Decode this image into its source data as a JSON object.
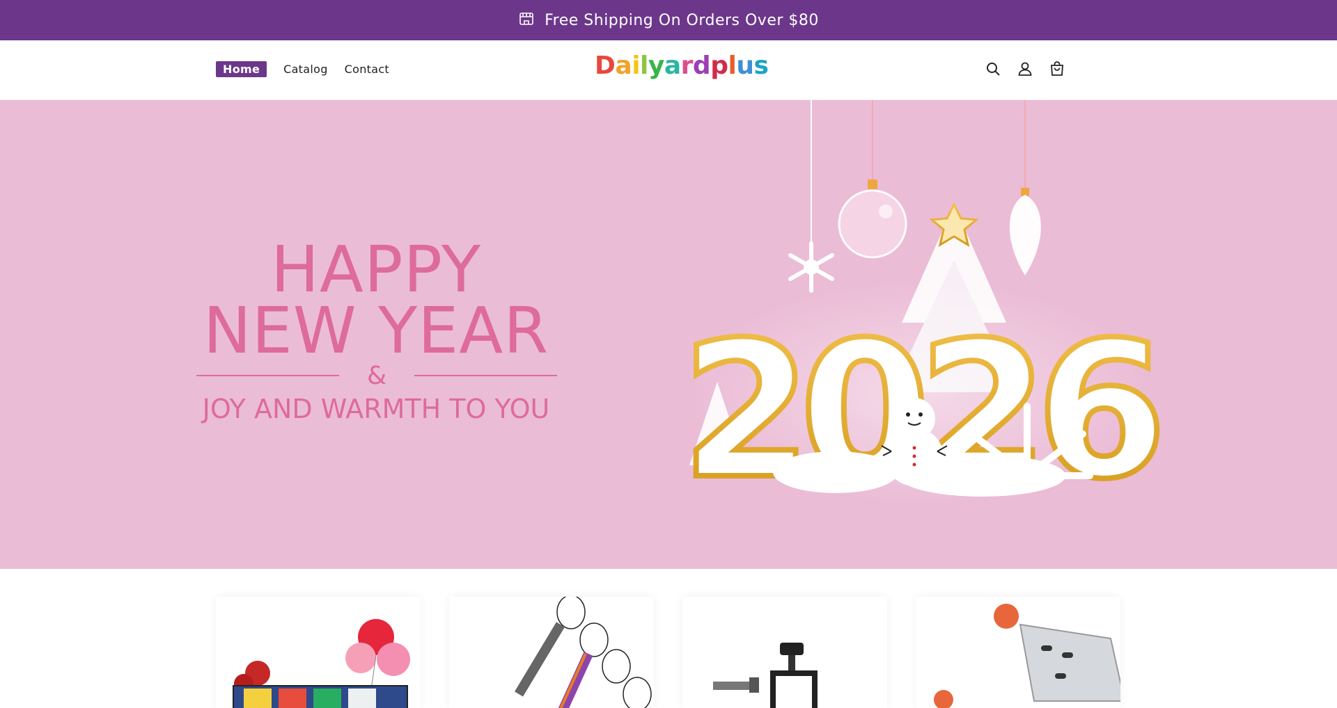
{
  "announcement": {
    "text": "Free Shipping On Orders Over $80",
    "icon": "store-icon"
  },
  "header": {
    "nav": [
      {
        "label": "Home",
        "active": true
      },
      {
        "label": "Catalog",
        "active": false
      },
      {
        "label": "Contact",
        "active": false
      }
    ],
    "logo": {
      "text": "Dailyardplus",
      "letters": [
        "D",
        "a",
        "i",
        "l",
        "y",
        "a",
        "r",
        "d",
        "p",
        "l",
        "u",
        "s"
      ],
      "colors": [
        "#e8473b",
        "#f0a32a",
        "#f5c518",
        "#8cc63f",
        "#38b44a",
        "#2bb5a3",
        "#e04d8a",
        "#9b3fb5",
        "#d12b4b",
        "#e85d2a",
        "#3f8fd6",
        "#1ba3c6"
      ]
    },
    "icons": [
      "search-icon",
      "account-icon",
      "cart-icon"
    ]
  },
  "hero": {
    "line1": "HAPPY",
    "line2": "NEW YEAR",
    "ampersand": "&",
    "line3": "JOY AND WARMTH TO YOU",
    "year": "2026",
    "background_color": "#ebbcd6",
    "text_color": "#dd6b9b"
  },
  "products": [
    {
      "name": "license-plate-product"
    },
    {
      "name": "lanyard-product"
    },
    {
      "name": "clamp-product"
    },
    {
      "name": "corner-clamp-product"
    }
  ]
}
